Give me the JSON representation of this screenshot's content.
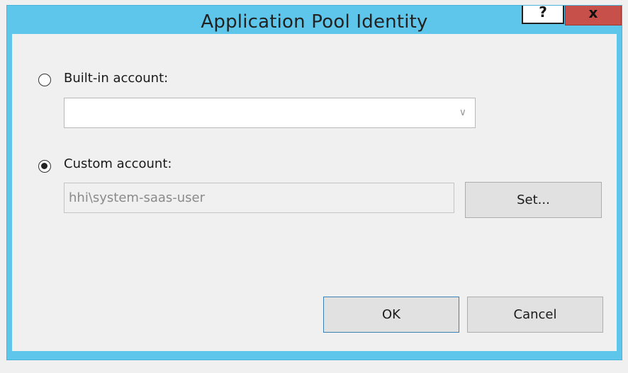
{
  "window": {
    "title": "Application Pool Identity",
    "help_glyph": "?",
    "close_glyph": "x"
  },
  "builtin": {
    "label": "Built-in account:",
    "selected": false,
    "combo_value": "",
    "chevron": "∨"
  },
  "custom": {
    "label": "Custom account:",
    "selected": true,
    "value": "hhi\\system-saas-user",
    "set_label": "Set..."
  },
  "buttons": {
    "ok": "OK",
    "cancel": "Cancel"
  }
}
